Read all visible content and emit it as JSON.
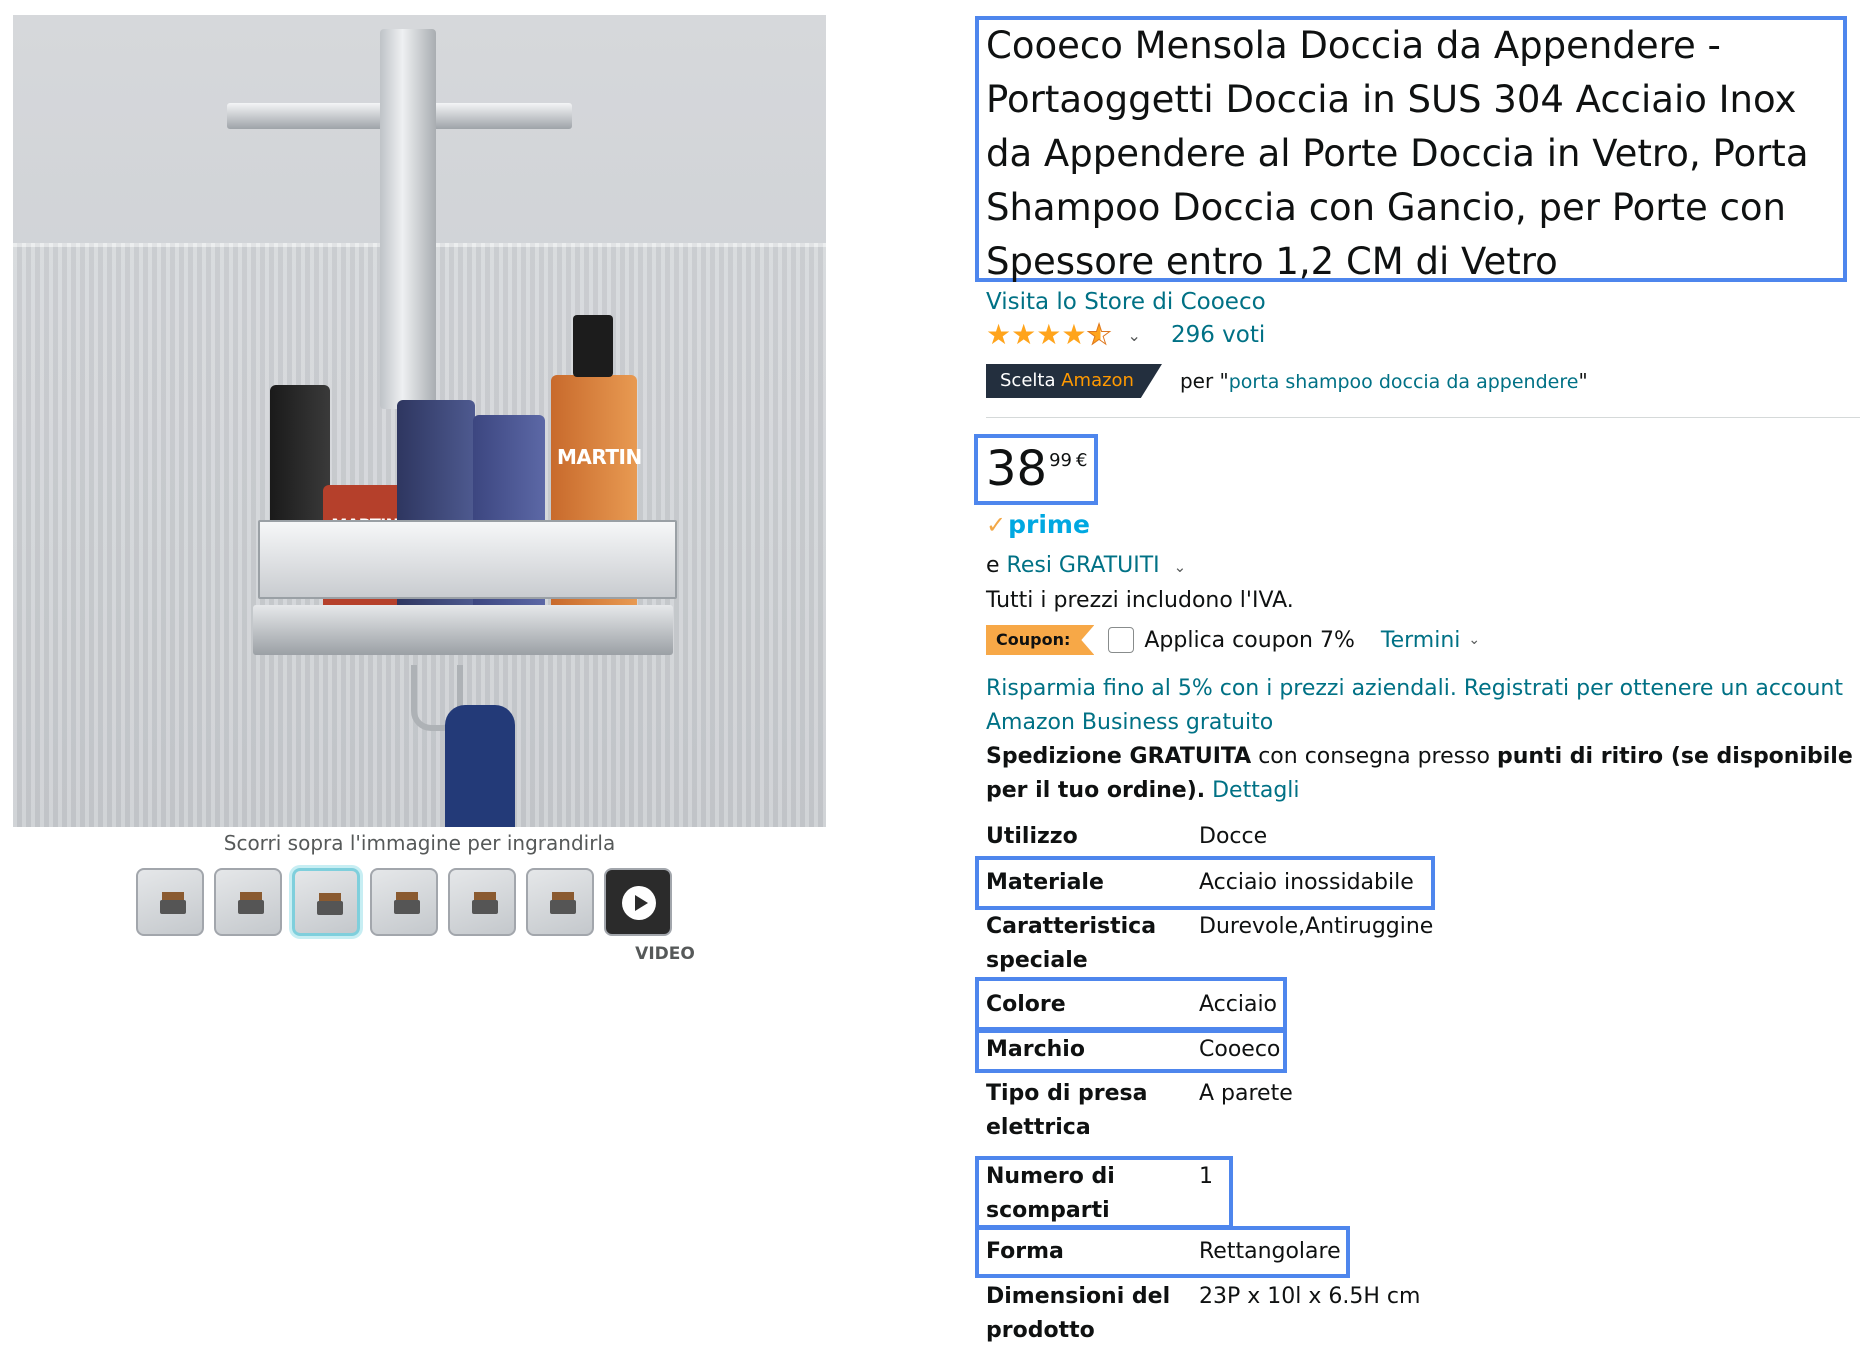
{
  "gallery": {
    "bottle_labels": [
      "MARTIN",
      "MARTIN"
    ],
    "zoom_hint": "Scorri sopra l'immagine per ingrandirla",
    "thumbnails": [
      {
        "name": "thumb-1",
        "selected": false
      },
      {
        "name": "thumb-2",
        "selected": false
      },
      {
        "name": "thumb-3",
        "selected": true
      },
      {
        "name": "thumb-4",
        "selected": false
      },
      {
        "name": "thumb-5",
        "selected": false
      },
      {
        "name": "thumb-6",
        "selected": false
      },
      {
        "name": "thumb-video",
        "selected": false
      }
    ],
    "video_label": "VIDEO"
  },
  "product": {
    "title": "Cooeco Mensola Doccia da Appendere - Portaoggetti Doccia in SUS 304 Acciaio Inox da Appendere al Porte Doccia in Vetro, Porta Shampoo Doccia con Gancio, per Porte con Spessore entro 1,2 CM di Vetro",
    "store_link": "Visita lo Store di Cooeco",
    "rating": {
      "stars": 4.5,
      "count_label": "296 voti"
    },
    "choice": {
      "badge_prefix": "Scelta ",
      "badge_brand": "Amazon",
      "per_label": "per \"",
      "keyword": "porta shampoo doccia da appendere",
      "closing_quote": "\""
    }
  },
  "pricing": {
    "whole": "38",
    "fraction": "99",
    "currency": "€",
    "prime_label": "prime",
    "returns_prefix": "e ",
    "returns_link": "Resi GRATUITI",
    "vat_text": "Tutti i prezzi includono l'IVA.",
    "coupon": {
      "badge": "Coupon:",
      "label": "Applica coupon 7%",
      "terms": "Termini"
    },
    "business_text": "Risparmia fino al 5% con i prezzi aziendali. Registrati per ottenere un account Amazon Business gratuito",
    "shipping": {
      "bold1": "Spedizione GRATUITA",
      "normal": " con consegna presso ",
      "bold2": "punti di ritiro (se disponibile per il tuo ordine).",
      "link": " Dettagli"
    }
  },
  "specs": [
    {
      "label": "Utilizzo",
      "value": "Docce"
    },
    {
      "label": "Materiale",
      "value": "Acciaio inossidabile"
    },
    {
      "label": "Caratteristica speciale",
      "value": "Durevole,Antiruggine"
    },
    {
      "label": "Colore",
      "value": "Acciaio"
    },
    {
      "label": "Marchio",
      "value": "Cooeco"
    },
    {
      "label": "Tipo di presa elettrica",
      "value": "A parete"
    },
    {
      "label": "Numero di scomparti",
      "value": "1"
    },
    {
      "label": "Forma",
      "value": "Rettangolare"
    },
    {
      "label": "Dimensioni del prodotto",
      "value": "23P x 10l x 6.5H cm"
    }
  ],
  "colors": {
    "highlight": "#4e86ed",
    "link": "#007185",
    "star": "#ffa41c",
    "coupon": "#f7a847",
    "choice_badge": "#232f3e",
    "prime": "#00a8e1"
  }
}
